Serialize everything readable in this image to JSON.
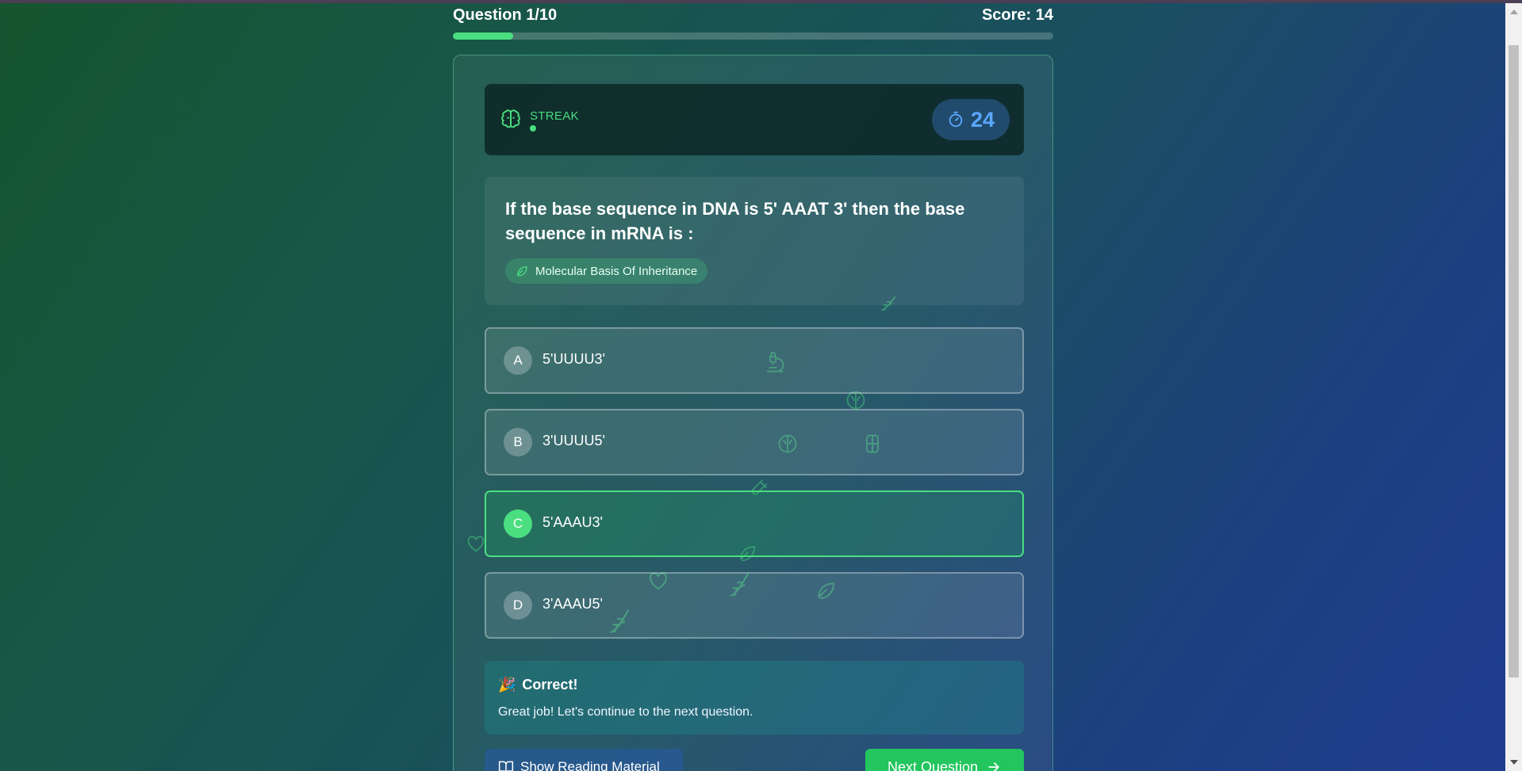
{
  "header": {
    "question_counter": "Question 1/10",
    "score": "Score: 14",
    "progress_fraction": 0.1
  },
  "streak": {
    "label": "STREAK",
    "icon": "brain-icon"
  },
  "timer": {
    "value": "24",
    "icon": "stopwatch-icon"
  },
  "question": {
    "text": "If the base sequence in DNA is 5' AAAT 3' then the base sequence in mRNA is :",
    "topic": "Molecular Basis Of Inheritance",
    "topic_icon": "leaf-icon"
  },
  "options": [
    {
      "letter": "A",
      "text": "5'UUUU3'",
      "selected": false
    },
    {
      "letter": "B",
      "text": "3'UUUU5'",
      "selected": false
    },
    {
      "letter": "C",
      "text": "5'AAAU3'",
      "selected": true
    },
    {
      "letter": "D",
      "text": "3'AAAU5'",
      "selected": false
    }
  ],
  "feedback": {
    "emoji": "🎉",
    "title": "Correct!",
    "message": "Great job! Let's continue to the next question."
  },
  "actions": {
    "reading_label": "Show Reading Material",
    "next_label": "Next Question"
  },
  "colors": {
    "accent_green": "#4ade80",
    "button_green": "#22c55e",
    "timer_blue": "#5aa6ff"
  }
}
